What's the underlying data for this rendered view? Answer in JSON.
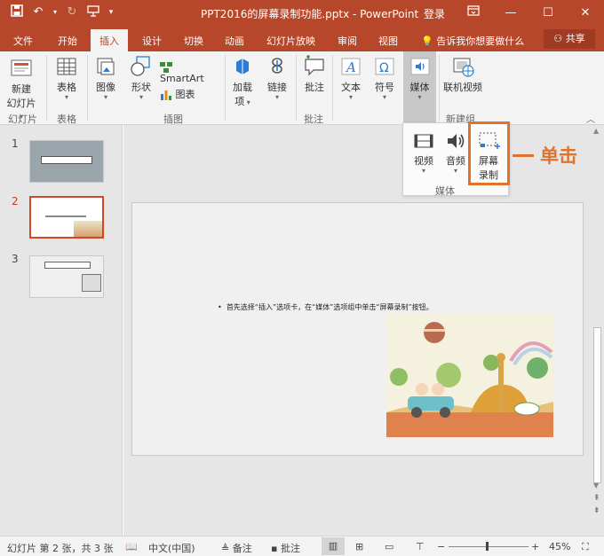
{
  "titlebar": {
    "title": "PPT2016的屏幕录制功能.pptx  -  PowerPoint",
    "login": "登录",
    "qat_icons": [
      "save-icon",
      "undo-icon",
      "redo-icon",
      "slideshow-icon"
    ],
    "accent": "#b7472a"
  },
  "tabs": [
    {
      "label": "文件"
    },
    {
      "label": "开始"
    },
    {
      "label": "插入",
      "active": true
    },
    {
      "label": "设计"
    },
    {
      "label": "切换"
    },
    {
      "label": "动画"
    },
    {
      "label": "幻灯片放映"
    },
    {
      "label": "审阅"
    },
    {
      "label": "视图"
    }
  ],
  "tellme": "告诉我你想要做什么",
  "share": "共享",
  "ribbon": {
    "groups": [
      {
        "label": "幻灯片",
        "buttons": [
          "新建\n幻灯片"
        ]
      },
      {
        "label": "表格",
        "buttons": [
          "表格"
        ]
      },
      {
        "label": "插图",
        "buttons": [
          "图像",
          "形状",
          "SmartArt",
          "图表"
        ]
      },
      {
        "label": "",
        "buttons": [
          "加载项",
          "链接"
        ]
      },
      {
        "label": "批注",
        "buttons": [
          "批注"
        ]
      },
      {
        "label": "",
        "buttons": [
          "文本",
          "符号",
          "媒体"
        ]
      },
      {
        "label": "新建组",
        "buttons": [
          "联机视频"
        ]
      }
    ],
    "new_slide_1": "新建",
    "new_slide_2": "幻灯片",
    "table": "表格",
    "image": "图像",
    "shapes": "形状",
    "smartart": "SmartArt",
    "chart": "图表",
    "addins_1": "加载",
    "addins_2": "项",
    "link": "链接",
    "comment": "批注",
    "text": "文本",
    "symbol": "符号",
    "media": "媒体",
    "online_video": "联机视频",
    "group_slides": "幻灯片",
    "group_table": "表格",
    "group_illus": "插图",
    "group_comments": "批注",
    "group_new": "新建组"
  },
  "media_dropdown": {
    "video": "视频",
    "audio": "音频",
    "screen_1": "屏幕",
    "screen_2": "录制",
    "group": "媒体"
  },
  "annotation": "单击",
  "annotation_color": "#e0732c",
  "slides_panel": [
    {
      "number": "1"
    },
    {
      "number": "2",
      "active": true
    },
    {
      "number": "3"
    }
  ],
  "slide": {
    "text": "首先选择“插入”选项卡，在“媒体”选项组中单击“屏幕录制”按钮。"
  },
  "statusbar": {
    "slide_info": "幻灯片 第 2 张，共 3 张",
    "language": "中文(中国)",
    "notes": "备注",
    "comments": "批注",
    "zoom": "45%"
  }
}
